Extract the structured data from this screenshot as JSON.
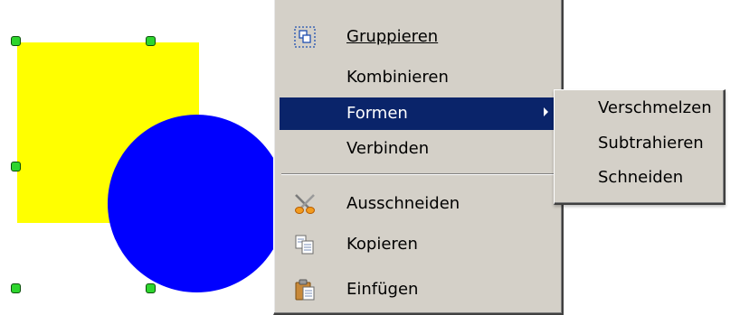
{
  "context_menu": {
    "items": [
      {
        "label": "Gruppieren",
        "icon": "group-icon"
      },
      {
        "label": "Kombinieren",
        "icon": null
      },
      {
        "label": "Formen",
        "icon": null,
        "has_submenu": true,
        "highlighted": true
      },
      {
        "label": "Verbinden",
        "icon": null
      },
      {
        "label": "Ausschneiden",
        "icon": "scissors-icon"
      },
      {
        "label": "Kopieren",
        "icon": "copy-icon"
      },
      {
        "label": "Einfügen",
        "icon": "paste-icon"
      }
    ],
    "highlight_color": "#0a246a",
    "background_color": "#d4d0c8"
  },
  "shapes_submenu": {
    "items": [
      {
        "label": "Verschmelzen"
      },
      {
        "label": "Subtrahieren"
      },
      {
        "label": "Schneiden"
      }
    ]
  },
  "canvas": {
    "rectangle_color": "#ffff00",
    "circle_color": "#0000ff",
    "handle_color": "#2ed52e"
  }
}
